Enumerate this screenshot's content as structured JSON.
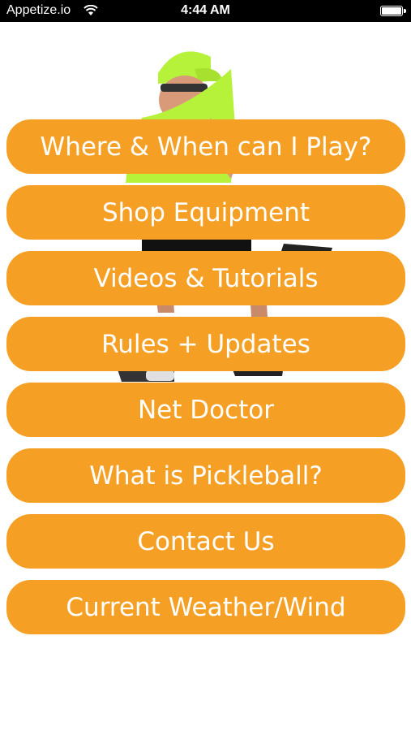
{
  "status_bar": {
    "carrier": "Appetize.io",
    "time": "4:44 AM",
    "icons": [
      "wifi-icon",
      "battery-icon"
    ]
  },
  "hero_image": {
    "subject": "pickleball-player",
    "shirt_color": "#b6f23a",
    "cap_color": "#b6f23a"
  },
  "menu": {
    "accent_color": "#f5a024",
    "items": [
      {
        "label": "Where & When can I Play?"
      },
      {
        "label": "Shop Equipment"
      },
      {
        "label": "Videos & Tutorials"
      },
      {
        "label": "Rules + Updates"
      },
      {
        "label": "Net Doctor"
      },
      {
        "label": "What is Pickleball?"
      },
      {
        "label": "Contact Us"
      },
      {
        "label": "Current Weather/Wind"
      }
    ]
  }
}
